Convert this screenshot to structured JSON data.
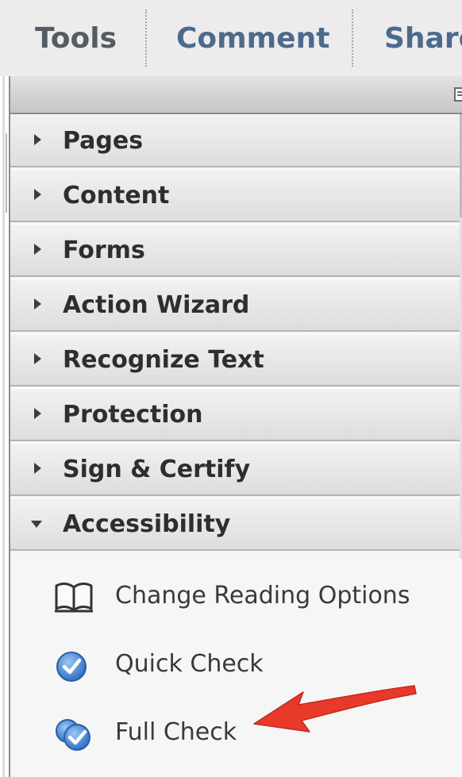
{
  "tabs": [
    {
      "label": "Tools",
      "active": true
    },
    {
      "label": "Comment",
      "active": false
    },
    {
      "label": "Share",
      "active": false
    }
  ],
  "panel": {
    "menu_icon": "panel-options-icon",
    "sections": [
      {
        "label": "Pages",
        "expanded": false
      },
      {
        "label": "Content",
        "expanded": false
      },
      {
        "label": "Forms",
        "expanded": false
      },
      {
        "label": "Action Wizard",
        "expanded": false
      },
      {
        "label": "Recognize Text",
        "expanded": false
      },
      {
        "label": "Protection",
        "expanded": false
      },
      {
        "label": "Sign & Certify",
        "expanded": false
      },
      {
        "label": "Accessibility",
        "expanded": true
      }
    ],
    "accessibility_items": [
      {
        "label": "Change Reading Options",
        "icon": "book-icon"
      },
      {
        "label": "Quick Check",
        "icon": "check-circle-icon"
      },
      {
        "label": "Full Check",
        "icon": "double-check-circle-icon"
      }
    ]
  },
  "annotation": {
    "arrow_color": "#e8392a",
    "points_to": "Full Check"
  },
  "colors": {
    "tab_text": "#4d6a8c",
    "active_tab_text": "#555c64",
    "icon_blue": "#3a7fd0"
  }
}
